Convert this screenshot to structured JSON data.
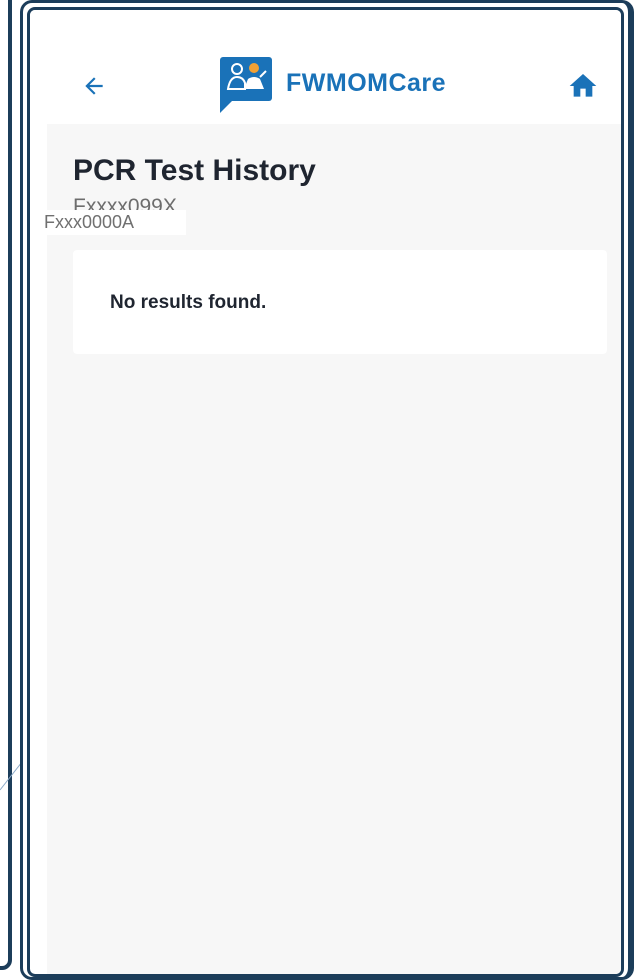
{
  "header": {
    "brand": "FWMOMCare",
    "icons": {
      "back": "arrow-left-icon",
      "home": "home-icon",
      "logo": "fwmomcare-logo-icon"
    },
    "accent_color": "#1a72b8"
  },
  "page": {
    "title": "PCR Test History",
    "subtitle": "Fxxxx099X",
    "overlay_label": "Fxxx0000A",
    "empty_message": "No results found."
  },
  "colors": {
    "frame": "#1c3d5a",
    "content_bg": "#f7f7f7",
    "text_dark": "#1f2530"
  }
}
